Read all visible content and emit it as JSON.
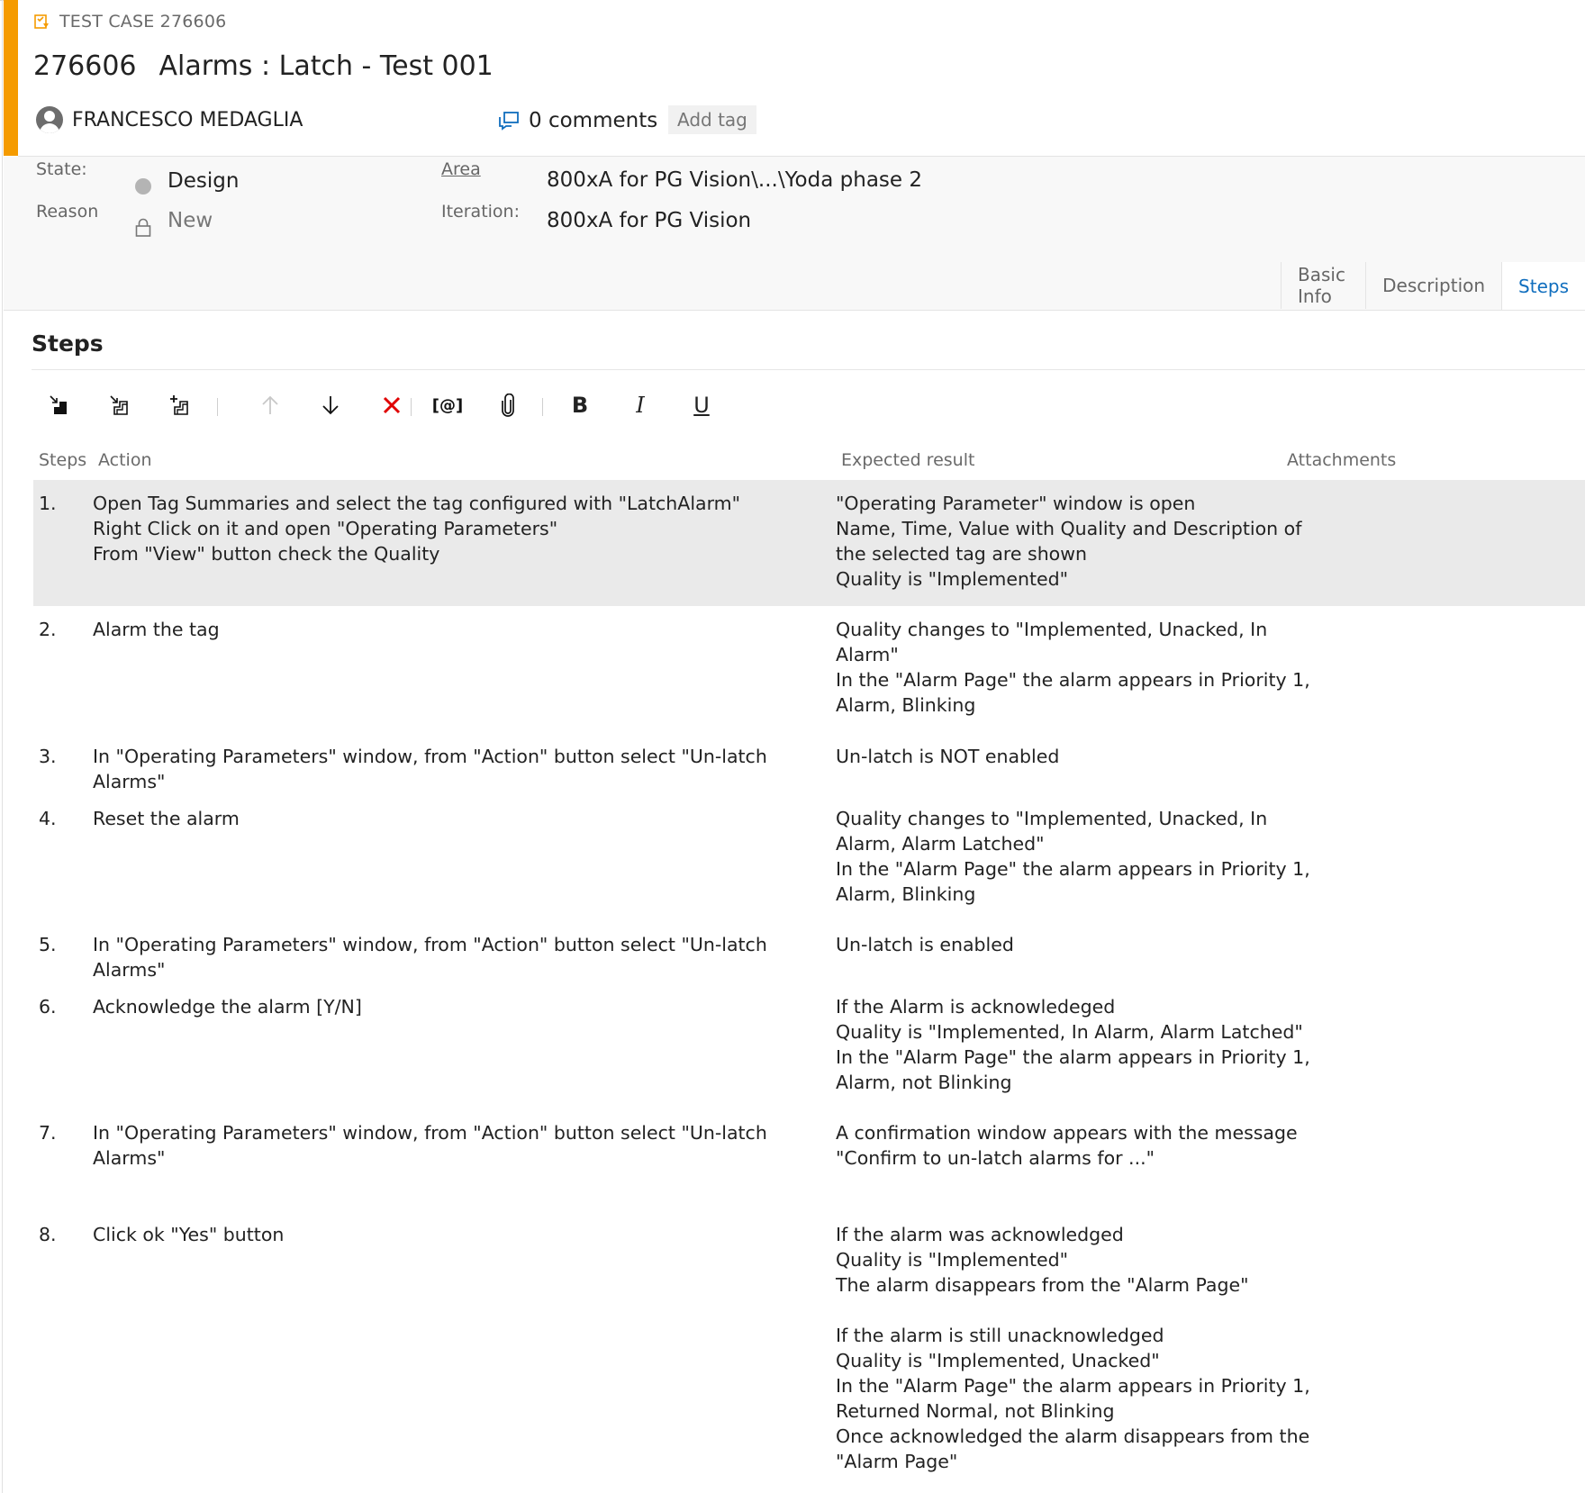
{
  "header": {
    "type_label": "TEST CASE 276606",
    "id": "276606",
    "title": "Alarms : Latch - Test 001",
    "assigned_to": "FRANCESCO MEDAGLIA",
    "comments": "0 comments",
    "add_tag": "Add tag"
  },
  "fields": {
    "state_label": "State:",
    "state_value": "Design",
    "reason_label": "Reason",
    "reason_value": "New",
    "area_label": "Area",
    "area_value": "800xA for PG Vision\\...\\Yoda phase 2",
    "iteration_label": "Iteration:",
    "iteration_value": "800xA for PG Vision"
  },
  "tabs": [
    {
      "label": "Basic Info",
      "active": false
    },
    {
      "label": "Description",
      "active": false
    },
    {
      "label": "Steps",
      "active": true
    }
  ],
  "steps_section": {
    "title": "Steps",
    "toolbar": {
      "insert_step": "insert-step-icon",
      "insert_shared_steps": "insert-shared-steps-icon",
      "create_shared_steps": "create-shared-steps-icon",
      "move_up": "arrow-up-icon",
      "move_down": "arrow-down-icon",
      "delete": "delete-icon",
      "parameter_label": "[@]",
      "attach": "paperclip-icon",
      "bold_label": "B",
      "italic_label": "I",
      "underline_label": "U"
    },
    "columns": {
      "steps": "Steps",
      "action": "Action",
      "expected": "Expected result",
      "attachments": "Attachments"
    },
    "rows": [
      {
        "num": "1.",
        "action": "Open Tag Summaries and select the tag configured with \"LatchAlarm\"\nRight Click on it and open \"Operating Parameters\"\nFrom \"View\" button check the Quality",
        "expected": "\"Operating Parameter\" window is open\nName, Time, Value with Quality and Description of\nthe selected tag are shown\nQuality is \"Implemented\""
      },
      {
        "num": "2.",
        "action": "Alarm the tag",
        "expected": "Quality changes to \"Implemented, Unacked, In\nAlarm\"\nIn the \"Alarm Page\" the alarm appears in Priority 1,\nAlarm, Blinking"
      },
      {
        "num": "3.",
        "action": "In \"Operating Parameters\" window, from \"Action\" button select \"Un-latch Alarms\"",
        "expected": "Un-latch is NOT enabled"
      },
      {
        "num": "4.",
        "action": "Reset the alarm",
        "expected": "Quality changes to \"Implemented, Unacked, In\nAlarm, Alarm Latched\"\nIn the \"Alarm Page\" the alarm appears in Priority 1,\nAlarm, Blinking"
      },
      {
        "num": "5.",
        "action": "In \"Operating Parameters\" window, from \"Action\" button select \"Un-latch Alarms\"",
        "expected": "Un-latch is enabled"
      },
      {
        "num": "6.",
        "action": "Acknowledge the alarm [Y/N]",
        "expected": "If the Alarm is acknowledeged\nQuality is \"Implemented, In Alarm, Alarm Latched\"\nIn the \"Alarm Page\" the alarm appears in Priority 1,\nAlarm, not Blinking"
      },
      {
        "num": "7.",
        "action": "In \"Operating Parameters\" window, from \"Action\" button select \"Un-latch Alarms\"",
        "expected": "A confirmation window appears with the message\n\"Confirm to un-latch alarms for ...\""
      },
      {
        "num": "8.",
        "action": "Click ok \"Yes\" button",
        "expected": "If the alarm was acknowledged\nQuality is \"Implemented\"\nThe alarm disappears from the \"Alarm Page\"\n\nIf the alarm is still unacknowledged\nQuality is \"Implemented, Unacked\"\nIn the \"Alarm Page\" the alarm appears in Priority 1,\nReturned Normal, not Blinking\nOnce acknowledged the alarm disappears from the\n\"Alarm Page\""
      }
    ]
  },
  "colors": {
    "accent": "#f59b00",
    "link_blue": "#106ebe",
    "delete_red": "#e00000",
    "selected_row": "#eaeaea"
  }
}
